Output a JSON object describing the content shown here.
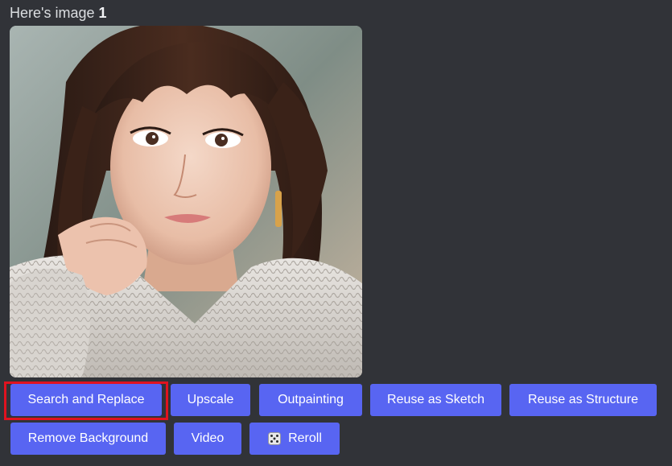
{
  "message": {
    "caption_prefix": "Here's image",
    "caption_number": "1"
  },
  "image": {
    "subject": "portrait photo",
    "icon": "image-thumbnail"
  },
  "buttons": {
    "search_and_replace": "Search and Replace",
    "upscale": "Upscale",
    "outpainting": "Outpainting",
    "reuse_as_sketch": "Reuse as Sketch",
    "reuse_as_structure": "Reuse as Structure",
    "remove_background": "Remove Background",
    "video": "Video",
    "reroll": "Reroll",
    "reroll_icon": "dice-icon"
  },
  "colors": {
    "background": "#313338",
    "button": "#5865f2",
    "button_text": "#ffffff",
    "highlight": "#e0131f"
  }
}
